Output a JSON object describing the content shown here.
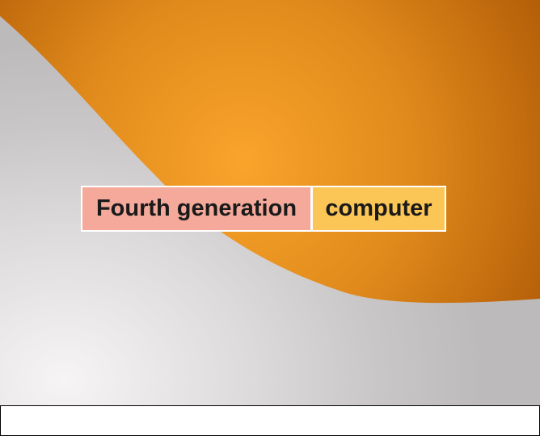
{
  "slide": {
    "title_part_1": "Fourth generation",
    "title_part_2": "computer"
  },
  "colors": {
    "orange_light": "#f9a42b",
    "orange_dark": "#b35d08",
    "gray_background": "#c9c6c7",
    "title_part_1_fill": "#f4a99a",
    "title_part_2_fill": "#fcc656"
  },
  "caption": {
    "text": ""
  }
}
